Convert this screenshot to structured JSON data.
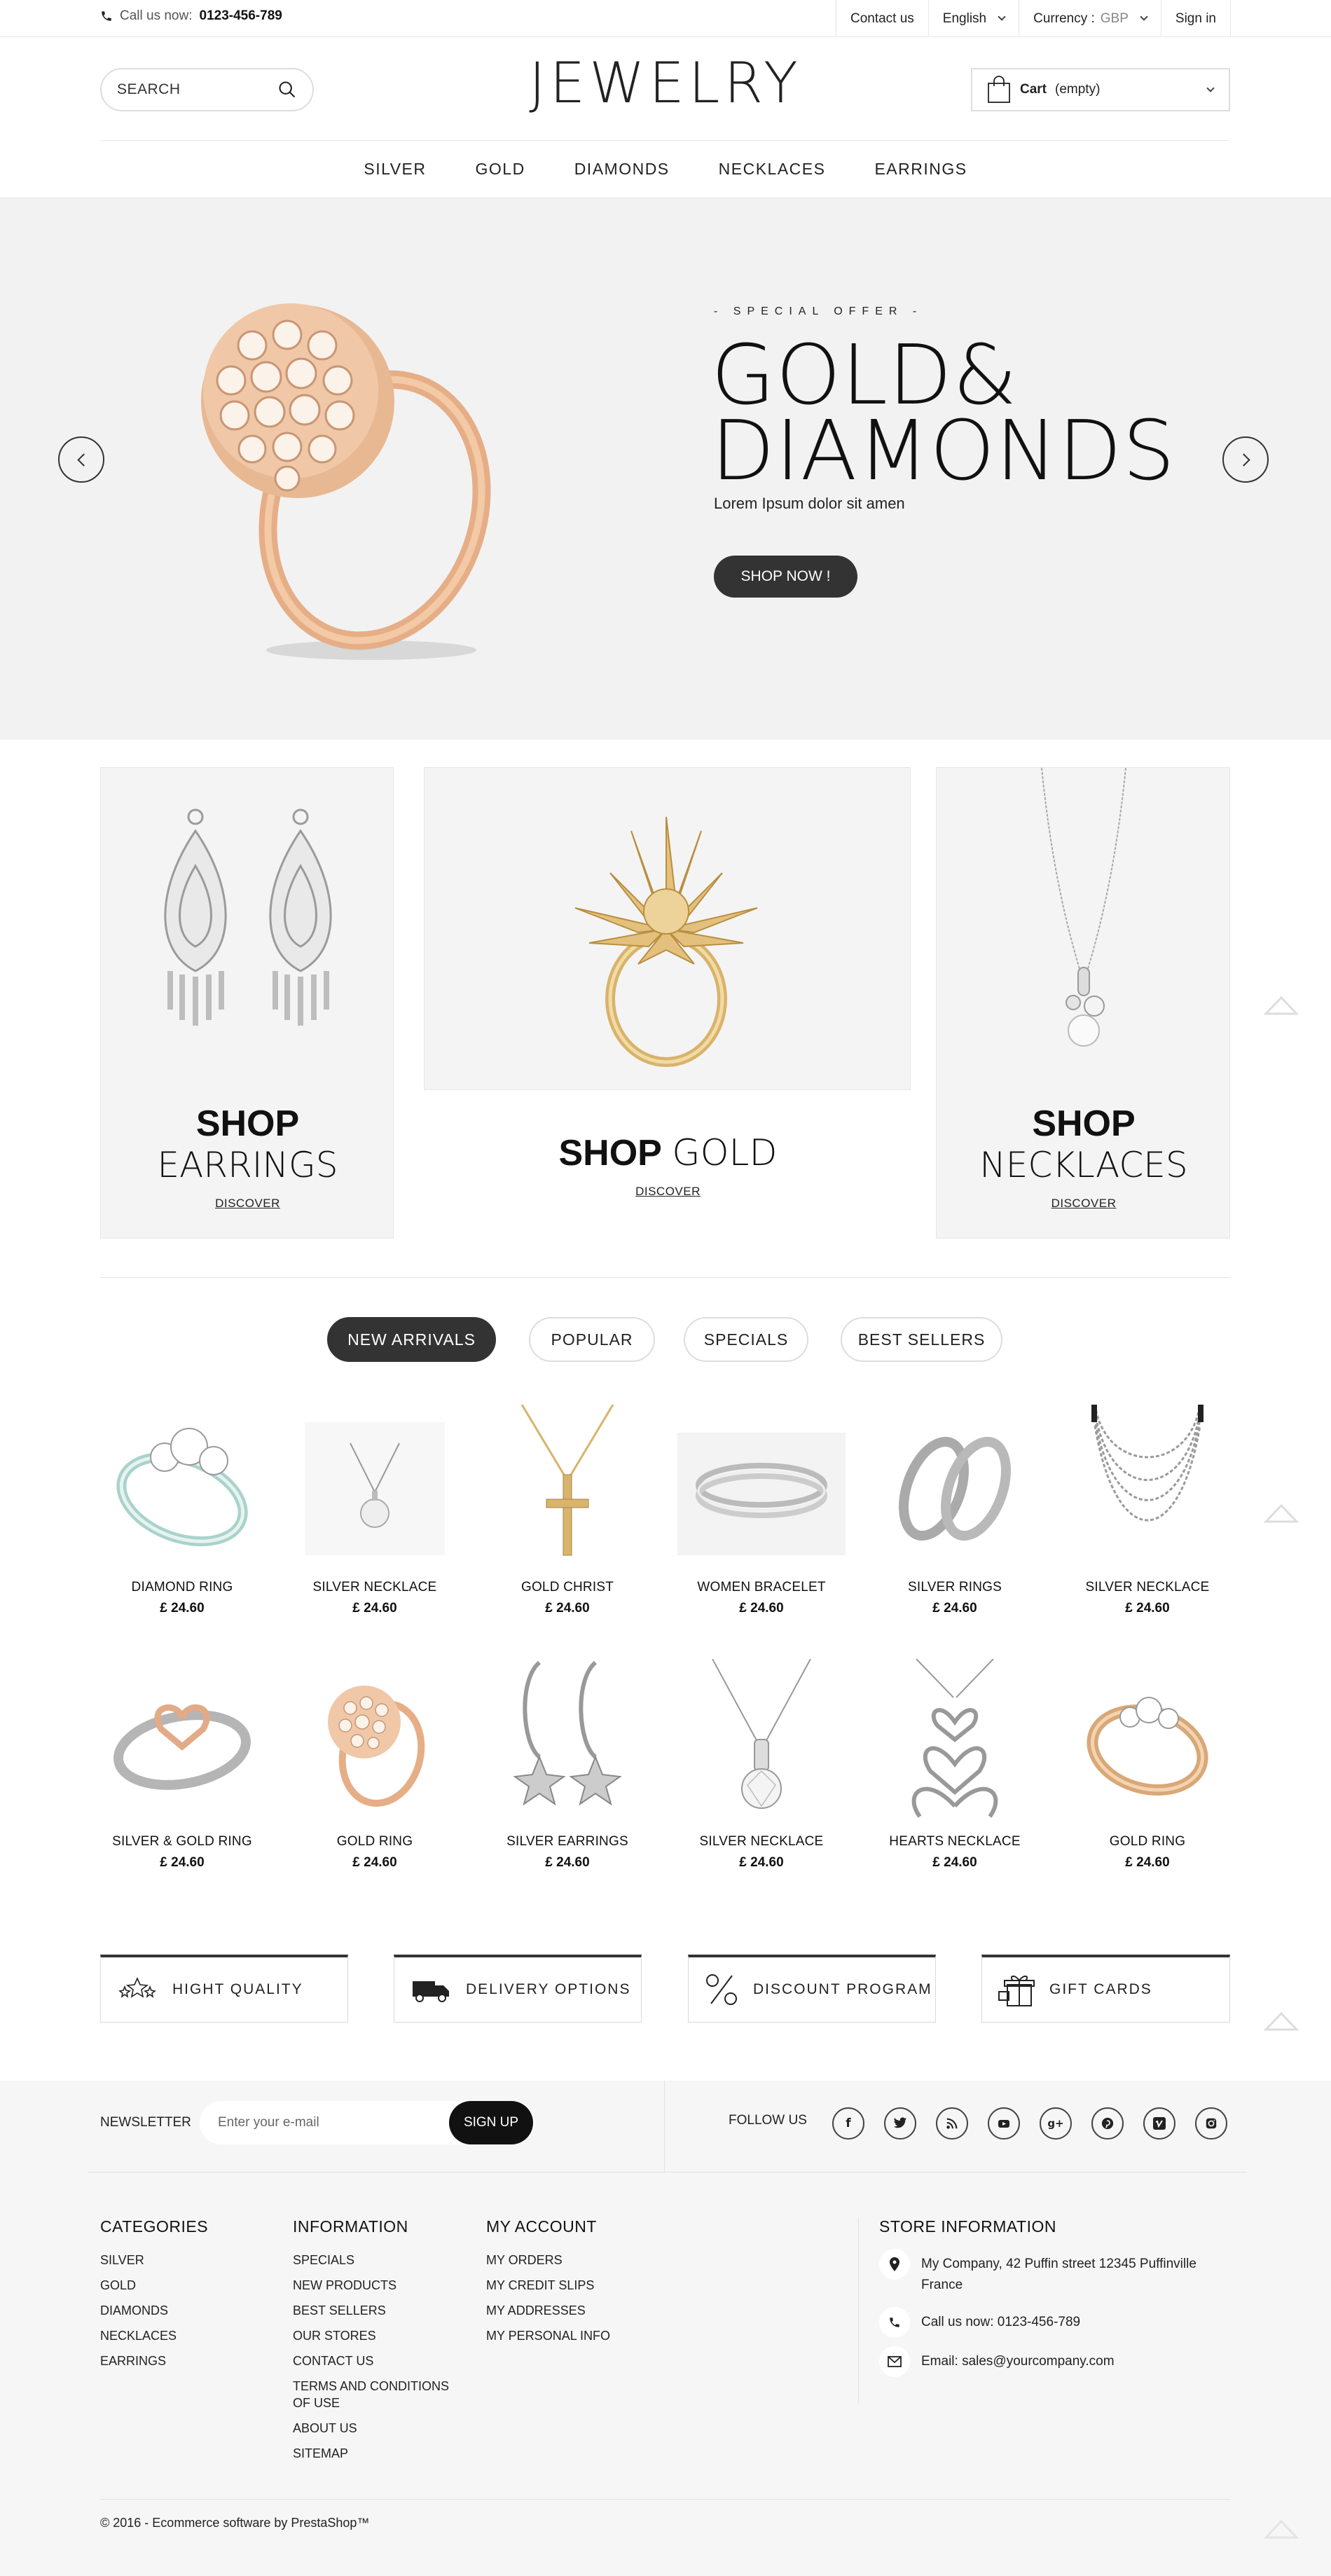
{
  "topbar": {
    "call_label": "Call us now:",
    "phone": "0123-456-789",
    "contact": "Contact us",
    "language": "English",
    "currency_label": "Currency :",
    "currency_value": "GBP",
    "signin": "Sign in"
  },
  "header": {
    "search_placeholder": "SEARCH",
    "logo": "JEWELRY",
    "cart_label": "Cart",
    "cart_status": "(empty)"
  },
  "nav": [
    "SILVER",
    "GOLD",
    "DIAMONDS",
    "NECKLACES",
    "EARRINGS"
  ],
  "hero": {
    "kicker": "- SPECIAL OFFER -",
    "title_line1": "GOLD&",
    "title_line2": "DIAMONDS",
    "subtitle": "Lorem Ipsum dolor sit amen",
    "cta": "SHOP NOW !"
  },
  "banners": {
    "earrings": {
      "bold": "SHOP",
      "light": "EARRINGS",
      "link": "DISCOVER"
    },
    "gold": {
      "bold": "SHOP",
      "light": "GOLD",
      "link": "DISCOVER"
    },
    "necklaces": {
      "bold": "SHOP",
      "light": "NECKLACES",
      "link": "DISCOVER"
    }
  },
  "tabs": [
    "NEW ARRIVALS",
    "POPULAR",
    "SPECIALS",
    "BEST SELLERS"
  ],
  "products": [
    {
      "name": "DIAMOND RING",
      "price": "£ 24.60"
    },
    {
      "name": "SILVER NECKLACE",
      "price": "£ 24.60"
    },
    {
      "name": "GOLD CHRIST",
      "price": "£ 24.60"
    },
    {
      "name": "WOMEN BRACELET",
      "price": "£ 24.60"
    },
    {
      "name": "SILVER RINGS",
      "price": "£ 24.60"
    },
    {
      "name": "SILVER NECKLACE",
      "price": "£ 24.60"
    },
    {
      "name": "SILVER & GOLD RING",
      "price": "£ 24.60"
    },
    {
      "name": "GOLD RING",
      "price": "£ 24.60"
    },
    {
      "name": "SILVER EARRINGS",
      "price": "£ 24.60"
    },
    {
      "name": "SILVER NECKLACE",
      "price": "£ 24.60"
    },
    {
      "name": "HEARTS NECKLACE",
      "price": "£ 24.60"
    },
    {
      "name": "GOLD RING",
      "price": "£ 24.60"
    }
  ],
  "features": [
    "HIGHT QUALITY",
    "DELIVERY OPTIONS",
    "DISCOUNT PROGRAM",
    "GIFT CARDS"
  ],
  "footer": {
    "newsletter_label": "NEWSLETTER",
    "email_placeholder": "Enter your e-mail",
    "signup": "SIGN UP",
    "follow_label": "FOLLOW US",
    "social": [
      "facebook-icon",
      "twitter-icon",
      "rss-icon",
      "youtube-icon",
      "google-plus-icon",
      "pinterest-icon",
      "vimeo-icon",
      "instagram-icon"
    ],
    "categories": {
      "title": "CATEGORIES",
      "items": [
        "SILVER",
        "GOLD",
        "DIAMONDS",
        "NECKLACES",
        "EARRINGS"
      ]
    },
    "information": {
      "title": "INFORMATION",
      "items": [
        "SPECIALS",
        "NEW PRODUCTS",
        "BEST SELLERS",
        "OUR STORES",
        "CONTACT US",
        "TERMS AND CONDITIONS OF USE",
        "ABOUT US",
        "SITEMAP"
      ]
    },
    "account": {
      "title": "MY ACCOUNT",
      "items": [
        "MY ORDERS",
        "MY CREDIT SLIPS",
        "MY ADDRESSES",
        "MY PERSONAL INFO"
      ]
    },
    "store": {
      "title": "STORE INFORMATION",
      "address": "My Company, 42 Puffin street 12345 Puffinville France",
      "phone": "Call us now: 0123-456-789",
      "email": "Email: sales@yourcompany.com"
    },
    "copyright": "© 2016 - Ecommerce software by PrestaShop™"
  },
  "colors": {
    "accent": "#333333",
    "hero_bg": "#f2f2f2",
    "footer_bg": "#f6f6f6",
    "gold": "#e3b48f"
  }
}
